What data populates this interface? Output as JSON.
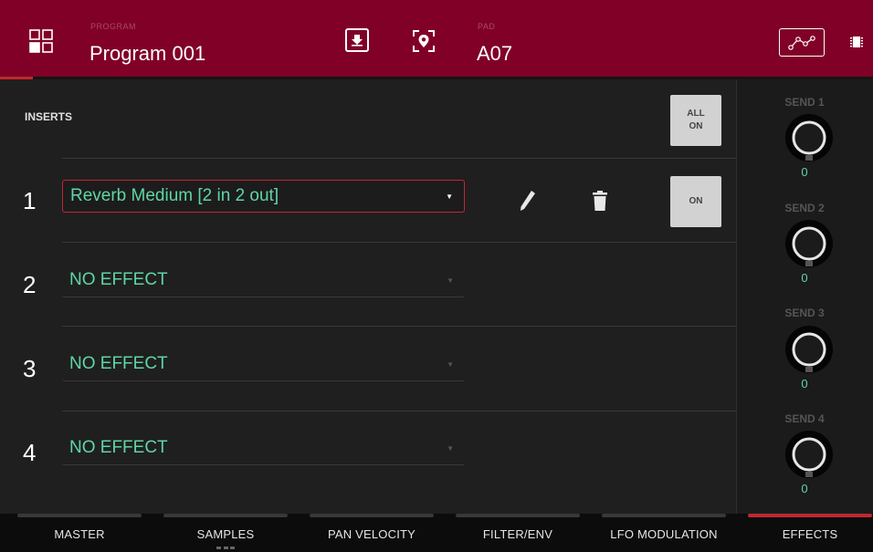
{
  "header": {
    "program_label": "PROGRAM",
    "program_name": "Program 001",
    "pad_label": "PAD",
    "pad_name": "A07"
  },
  "inserts": {
    "title": "INSERTS",
    "all_on_label": "ALL\nON",
    "slots": [
      {
        "number": "1",
        "effect": "Reverb Medium [2 in 2 out]",
        "on_label": "ON"
      },
      {
        "number": "2",
        "effect": "NO EFFECT"
      },
      {
        "number": "3",
        "effect": "NO EFFECT"
      },
      {
        "number": "4",
        "effect": "NO EFFECT"
      }
    ]
  },
  "sends": [
    {
      "label": "SEND 1",
      "value": "0"
    },
    {
      "label": "SEND 2",
      "value": "0"
    },
    {
      "label": "SEND 3",
      "value": "0"
    },
    {
      "label": "SEND 4",
      "value": "0"
    }
  ],
  "tabs": [
    {
      "label": "MASTER"
    },
    {
      "label": "SAMPLES"
    },
    {
      "label": "PAN VELOCITY"
    },
    {
      "label": "FILTER/ENV"
    },
    {
      "label": "LFO MODULATION"
    },
    {
      "label": "EFFECTS"
    }
  ],
  "active_tab": "EFFECTS",
  "colors": {
    "header_bg": "#800028",
    "accent_red": "#c2272e",
    "value_green": "#5ed6a6"
  }
}
